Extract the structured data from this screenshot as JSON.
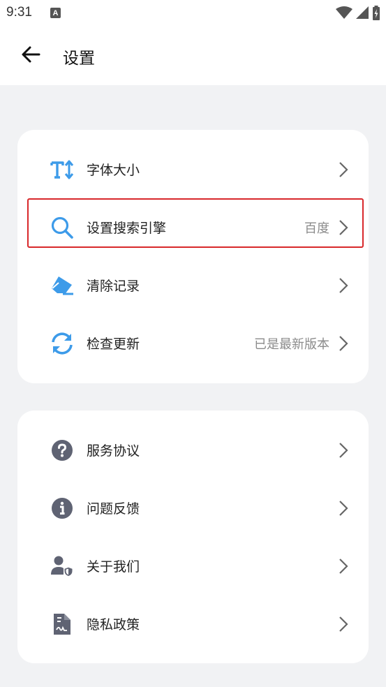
{
  "status_bar": {
    "time": "9:31",
    "notification_icon": "A",
    "icons": [
      "wifi-icon",
      "signal-icon",
      "battery-icon"
    ]
  },
  "header": {
    "title": "设置",
    "back_icon": "arrow-left-icon"
  },
  "groups": [
    {
      "items": [
        {
          "icon": "font-size-icon",
          "label": "字体大小",
          "value": ""
        },
        {
          "icon": "search-icon",
          "label": "设置搜索引擎",
          "value": "百度"
        },
        {
          "icon": "eraser-icon",
          "label": "清除记录",
          "value": ""
        },
        {
          "icon": "refresh-icon",
          "label": "检查更新",
          "value": "已是最新版本"
        }
      ]
    },
    {
      "items": [
        {
          "icon": "question-circle-icon",
          "label": "服务协议",
          "value": ""
        },
        {
          "icon": "info-circle-icon",
          "label": "问题反馈",
          "value": ""
        },
        {
          "icon": "user-shield-icon",
          "label": "关于我们",
          "value": ""
        },
        {
          "icon": "document-icon",
          "label": "隐私政策",
          "value": ""
        }
      ]
    }
  ],
  "colors": {
    "accent_blue": "#3d9be9",
    "icon_gray": "#5f6373",
    "highlight_red": "#d8282b",
    "background": "#f1f2f4"
  }
}
